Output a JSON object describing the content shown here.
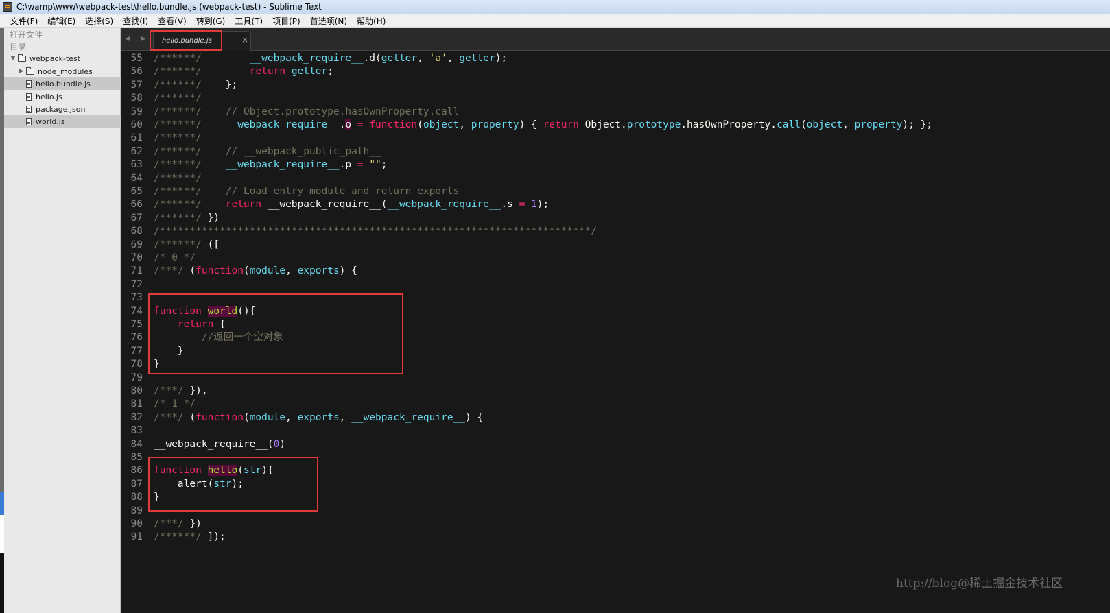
{
  "window": {
    "title": "C:\\wamp\\www\\webpack-test\\hello.bundle.js (webpack-test) - Sublime Text",
    "icon": "sublime-app-icon"
  },
  "menu": [
    "文件(F)",
    "编辑(E)",
    "选择(S)",
    "查找(I)",
    "查看(V)",
    "转到(G)",
    "工具(T)",
    "项目(P)",
    "首选项(N)",
    "帮助(H)"
  ],
  "sidebar": {
    "open_files_label": "打开文件",
    "folders_label": "目录",
    "tree": [
      {
        "label": "webpack-test",
        "type": "folder",
        "expanded": true
      },
      {
        "label": "node_modules",
        "type": "folder",
        "expanded": false
      },
      {
        "label": "hello.bundle.js",
        "type": "file",
        "selected": true
      },
      {
        "label": "hello.js",
        "type": "file",
        "selected": false
      },
      {
        "label": "package.json",
        "type": "file",
        "selected": false
      },
      {
        "label": "world.js",
        "type": "file",
        "selected": true
      }
    ]
  },
  "tabs": {
    "nav": "◀ ▶",
    "active": {
      "label": "hello.bundle.js",
      "close": "×"
    }
  },
  "editor": {
    "lines": [
      {
        "n": "55",
        "html": "<span class=\"cm\">/******/</span>        <span class=\"bl\">__webpack_require__</span>.d(<span class=\"bl\">getter</span>, <span class=\"str\">'a'</span>, <span class=\"bl\">getter</span>);"
      },
      {
        "n": "56",
        "html": "<span class=\"cm\">/******/</span>        <span class=\"kw\">return</span> <span class=\"bl\">getter</span>;"
      },
      {
        "n": "57",
        "html": "<span class=\"cm\">/******/</span>    };"
      },
      {
        "n": "58",
        "html": "<span class=\"cm\">/******/</span>"
      },
      {
        "n": "59",
        "html": "<span class=\"cm\">/******/</span>    <span class=\"cm\">// Object.prototype.hasOwnProperty.call</span>"
      },
      {
        "n": "60",
        "html": "<span class=\"cm\">/******/</span>    <span class=\"bl\">__webpack_require__</span>.<span class=\"sel\">o</span> <span class=\"kw\">=</span> <span class=\"kw\">function</span>(<span class=\"bl\">object</span>, <span class=\"bl\">property</span>) { <span class=\"kw\">return</span> Object.<span class=\"bl\">prototype</span>.hasOwnProperty.<span class=\"bl\">call</span>(<span class=\"bl\">object</span>, <span class=\"bl\">property</span>); };"
      },
      {
        "n": "61",
        "html": "<span class=\"cm\">/******/</span>"
      },
      {
        "n": "62",
        "html": "<span class=\"cm\">/******/</span>    <span class=\"cm\">// __webpack_public_path__</span>"
      },
      {
        "n": "63",
        "html": "<span class=\"cm\">/******/</span>    <span class=\"bl\">__webpack_require__</span>.p <span class=\"kw\">=</span> <span class=\"str\">\"\"</span>;"
      },
      {
        "n": "64",
        "html": "<span class=\"cm\">/******/</span>"
      },
      {
        "n": "65",
        "html": "<span class=\"cm\">/******/</span>    <span class=\"cm\">// Load entry module and return exports</span>"
      },
      {
        "n": "66",
        "html": "<span class=\"cm\">/******/</span>    <span class=\"kw\">return</span> __webpack_require__(<span class=\"bl\">__webpack_require__</span>.s <span class=\"kw\">=</span> <span class=\"num\">1</span>);"
      },
      {
        "n": "67",
        "html": "<span class=\"cm\">/******/</span> })"
      },
      {
        "n": "68",
        "html": "<span class=\"cm\">/************************************************************************/</span>"
      },
      {
        "n": "69",
        "html": "<span class=\"cm\">/******/</span> (["
      },
      {
        "n": "70",
        "html": "<span class=\"cm\">/* 0 */</span>"
      },
      {
        "n": "71",
        "html": "<span class=\"cm\">/***/</span> (<span class=\"kw\">function</span>(<span class=\"bl\">module</span>, <span class=\"bl\">exports</span>) {"
      },
      {
        "n": "72",
        "html": ""
      },
      {
        "n": "73",
        "html": ""
      },
      {
        "n": "74",
        "html": "<span class=\"kw\">function</span> <span class=\"fn sel\">world</span>(){"
      },
      {
        "n": "75",
        "html": "    <span class=\"kw\">return</span> {"
      },
      {
        "n": "76",
        "html": "        <span class=\"cm\">//返回一个空对象</span>"
      },
      {
        "n": "77",
        "html": "    }"
      },
      {
        "n": "78",
        "html": "}"
      },
      {
        "n": "79",
        "html": ""
      },
      {
        "n": "80",
        "html": "<span class=\"cm\">/***/</span> }),"
      },
      {
        "n": "81",
        "html": "<span class=\"cm\">/* 1 */</span>"
      },
      {
        "n": "82",
        "html": "<span class=\"cm\">/***/</span> (<span class=\"kw\">function</span>(<span class=\"bl\">module</span>, <span class=\"bl\">exports</span>, <span class=\"bl\">__webpack_require__</span>) {"
      },
      {
        "n": "83",
        "html": ""
      },
      {
        "n": "84",
        "html": "__webpack_require__(<span class=\"num\">0</span>)"
      },
      {
        "n": "85",
        "html": ""
      },
      {
        "n": "86",
        "html": "<span class=\"kw\">function</span> <span class=\"fn sel\">hello</span>(<span class=\"bl\">str</span>){"
      },
      {
        "n": "87",
        "html": "    alert(<span class=\"bl\">str</span>);"
      },
      {
        "n": "88",
        "html": "}"
      },
      {
        "n": "89",
        "html": ""
      },
      {
        "n": "90",
        "html": "<span class=\"cm\">/***/</span> })"
      },
      {
        "n": "91",
        "html": "<span class=\"cm\">/******/</span> ]);"
      }
    ]
  },
  "watermark": "http://blog@稀土掘金技术社区",
  "colors": {
    "editor_bg": "#181818",
    "keyword": "#f92672",
    "function_name": "#a6e22e",
    "builtin": "#66d9ef",
    "comment": "#75715e",
    "number": "#ae81ff",
    "string": "#e6db74",
    "highlight_box": "#e03a3a"
  }
}
